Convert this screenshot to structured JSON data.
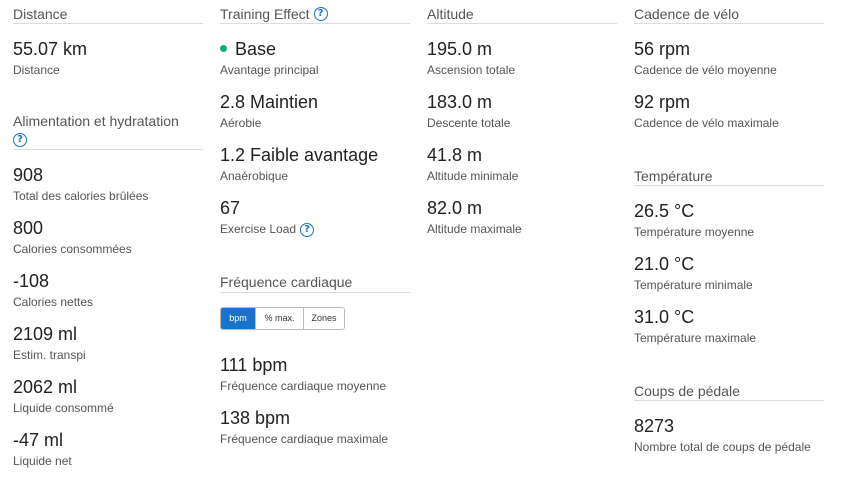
{
  "distance": {
    "title": "Distance",
    "stats": [
      {
        "value": "55.07 km",
        "label": "Distance"
      }
    ]
  },
  "nutrition": {
    "title": "Alimentation et hydratation",
    "stats": [
      {
        "value": "908",
        "label": "Total des calories brûlées"
      },
      {
        "value": "800",
        "label": "Calories consommées"
      },
      {
        "value": "-108",
        "label": "Calories nettes"
      },
      {
        "value": "2109 ml",
        "label": "Estim. transpi"
      },
      {
        "value": "2062 ml",
        "label": "Liquide consommé"
      },
      {
        "value": "-47 ml",
        "label": "Liquide net"
      }
    ]
  },
  "training": {
    "title": "Training Effect",
    "primary": {
      "value": "Base",
      "label": "Avantage principal",
      "dot_color": "#1aaa6c"
    },
    "aerobic": {
      "value": "2.8 Maintien",
      "label": "Aérobie"
    },
    "anaerobic": {
      "value": "1.2 Faible avantage",
      "label": "Anaérobique"
    },
    "load": {
      "value": "67",
      "label": "Exercise Load"
    }
  },
  "heart_rate": {
    "title": "Fréquence cardiaque",
    "tabs": [
      "bpm",
      "% max.",
      "Zones"
    ],
    "active_tab": "bpm",
    "stats": [
      {
        "value": "111 bpm",
        "label": "Fréquence cardiaque moyenne"
      },
      {
        "value": "138 bpm",
        "label": "Fréquence cardiaque maximale"
      }
    ]
  },
  "altitude": {
    "title": "Altitude",
    "stats": [
      {
        "value": "195.0 m",
        "label": "Ascension totale"
      },
      {
        "value": "183.0 m",
        "label": "Descente totale"
      },
      {
        "value": "41.8 m",
        "label": "Altitude minimale"
      },
      {
        "value": "82.0 m",
        "label": "Altitude maximale"
      }
    ]
  },
  "cadence": {
    "title": "Cadence de vélo",
    "stats": [
      {
        "value": "56 rpm",
        "label": "Cadence de vélo moyenne"
      },
      {
        "value": "92 rpm",
        "label": "Cadence de vélo maximale"
      }
    ]
  },
  "temperature": {
    "title": "Température",
    "stats": [
      {
        "value": "26.5 °C",
        "label": "Température moyenne"
      },
      {
        "value": "21.0 °C",
        "label": "Température minimale"
      },
      {
        "value": "31.0 °C",
        "label": "Température maximale"
      }
    ]
  },
  "strokes": {
    "title": "Coups de pédale",
    "stats": [
      {
        "value": "8273",
        "label": "Nombre total de coups de pédale"
      }
    ]
  },
  "accent_color": "#1a73c8"
}
